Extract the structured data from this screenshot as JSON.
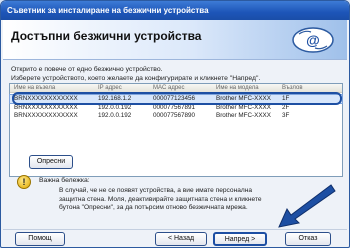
{
  "window": {
    "title": "Съветник за инсталиране на безжични устройства"
  },
  "header": {
    "title": "Достъпни безжични устройства",
    "logo_icon": "brother-at-logo"
  },
  "instructions": {
    "line1": "Открито е повече от едно безжично устройство.",
    "line2": "Изберете устройството, което желаете да конфигурирате и кликнете \"Напред\"."
  },
  "device_list": {
    "columns": [
      "Име на възела",
      "IP адрес",
      "MAC адрес",
      "Име на модела",
      "Възлов"
    ],
    "rows": [
      [
        "BRNXXXXXXXXXXXX",
        "192.168.1.2",
        "000077123456",
        "Brother MFC-XXXX",
        "1F"
      ],
      [
        "BRNXXXXXXXXXXXX",
        "192.0.0.192",
        "000077567891",
        "Brother MFC-XXXX",
        "2F"
      ],
      [
        "BRNXXXXXXXXXXXX",
        "192.0.0.192",
        "000077567890",
        "Brother MFC-XXXX",
        "3F"
      ]
    ],
    "selected_index": 0
  },
  "refresh_button": "Опресни",
  "notice": {
    "icon": "info-exclamation-icon",
    "title": "Важна бележка:",
    "line1": "В случай, че не се появят устройства, а вие имате персонална",
    "line2": "защитна стена. Моля, деактивирайте защитната стена и кликнете",
    "line3": "бутона \"Опресни\", за да потърсим отново безжичната мрежа."
  },
  "footer": {
    "help": "Помощ",
    "back": "< Назад",
    "next": "Напред >",
    "cancel": "Отказ"
  },
  "colors": {
    "accent": "#1d4fa3",
    "titlebar": "#1d55b8"
  }
}
